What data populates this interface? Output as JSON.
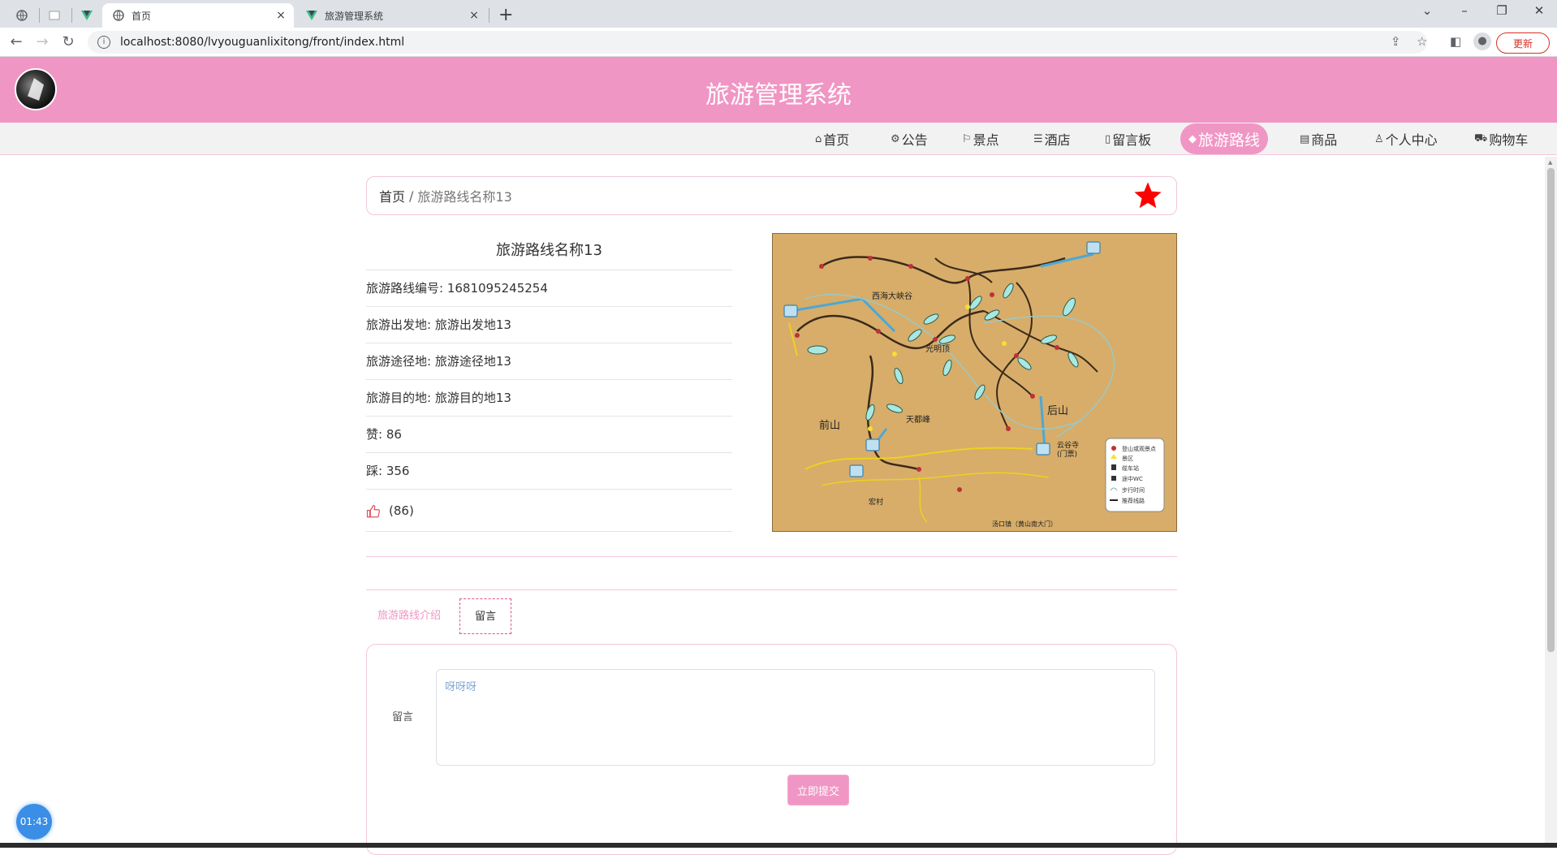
{
  "browser": {
    "tabs": [
      {
        "title": "",
        "icon": "globe-icon"
      },
      {
        "title": "",
        "icon": "blank-page-icon"
      },
      {
        "title": "",
        "icon": "vue-icon"
      },
      {
        "title": "首页",
        "icon": "globe-icon"
      },
      {
        "title": "旅游管理系统",
        "icon": "vue-icon"
      }
    ],
    "url": "localhost:8080/lvyouguanlixitong/front/index.html",
    "update_label": "更新"
  },
  "site": {
    "title": "旅游管理系统"
  },
  "nav": [
    {
      "label": "首页",
      "icon": "home-icon"
    },
    {
      "label": "公告",
      "icon": "gear-icon"
    },
    {
      "label": "景点",
      "icon": "flag-icon"
    },
    {
      "label": "酒店",
      "icon": "sliders-icon"
    },
    {
      "label": "留言板",
      "icon": "book-icon"
    },
    {
      "label": "旅游路线",
      "icon": "graduation-cap-icon",
      "active": true
    },
    {
      "label": "商品",
      "icon": "document-icon"
    },
    {
      "label": "个人中心",
      "icon": "user-icon"
    },
    {
      "label": "购物车",
      "icon": "cart-icon"
    }
  ],
  "breadcrumb": {
    "home": "首页",
    "separator": "/",
    "current": "旅游路线名称13"
  },
  "detail": {
    "name": "旅游路线名称13",
    "fields": [
      {
        "label": "旅游路线编号: ",
        "value": "1681095245254"
      },
      {
        "label": "旅游出发地: ",
        "value": "旅游出发地13"
      },
      {
        "label": "旅游途径地: ",
        "value": "旅游途径地13"
      },
      {
        "label": "旅游目的地: ",
        "value": "旅游目的地13"
      },
      {
        "label": "赞: ",
        "value": "86"
      },
      {
        "label": "踩: ",
        "value": "356"
      }
    ],
    "like_count": "(86)"
  },
  "map": {
    "labels": {
      "west_canyon": "西海大峡谷",
      "guangming": "光明顶",
      "tiandu": "天都峰",
      "front": "前山",
      "back": "后山",
      "yungu": "云谷寺",
      "yungu_gate": "(门票)",
      "hongcun": "宏村",
      "tangkou": "汤口镇（黄山南大门）"
    },
    "legend": [
      "登山或观景点",
      "景区",
      "缆车站",
      "途中WC",
      "步行时间",
      "推荐线路"
    ]
  },
  "tabs": [
    {
      "label": "旅游路线介绍"
    },
    {
      "label": "留言"
    }
  ],
  "message": {
    "label": "留言",
    "value": "呀呀呀",
    "submit_label": "立即提交"
  },
  "clock": "01:43",
  "colors": {
    "brand": "#f096c4",
    "star": "#ff0000"
  }
}
